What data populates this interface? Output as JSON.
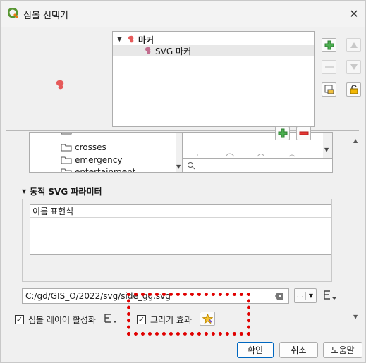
{
  "window": {
    "title": "심볼 선택기",
    "close_glyph": "✕"
  },
  "tree": {
    "parent_label": "마커",
    "child_label": "SVG 마커"
  },
  "folders": [
    "crosses",
    "emergency",
    "entertainment"
  ],
  "svg_filter": {
    "placeholder": ""
  },
  "params": {
    "section_title": "동적 SVG 파라미터",
    "columns": [
      "이름",
      "표현식"
    ]
  },
  "path": {
    "value": "C:/gd/GIS_O/2022/svg/side_gg.svg",
    "browse_label": "…"
  },
  "options": {
    "enable_layer_label": "심볼 레이어 활성화",
    "draw_effects_label": "그리기 효과",
    "enable_layer_checked": true,
    "draw_effects_checked": true
  },
  "buttons": {
    "ok": "확인",
    "cancel": "취소",
    "help": "도움말"
  },
  "colors": {
    "accent": "#0067c0",
    "highlight": "#e00000",
    "add_green": "#2e9d3a",
    "remove_red": "#d9262b",
    "lock": "#e5a200"
  },
  "icons": [
    "qgis-logo-icon",
    "marker-icon",
    "svg-marker-icon",
    "add-layer-icon",
    "remove-layer-icon",
    "move-up-icon",
    "move-down-icon",
    "duplicate-layer-icon",
    "lock-icon",
    "folder-icon",
    "search-icon",
    "clear-icon",
    "expression-icon",
    "paint-effect-icon"
  ]
}
